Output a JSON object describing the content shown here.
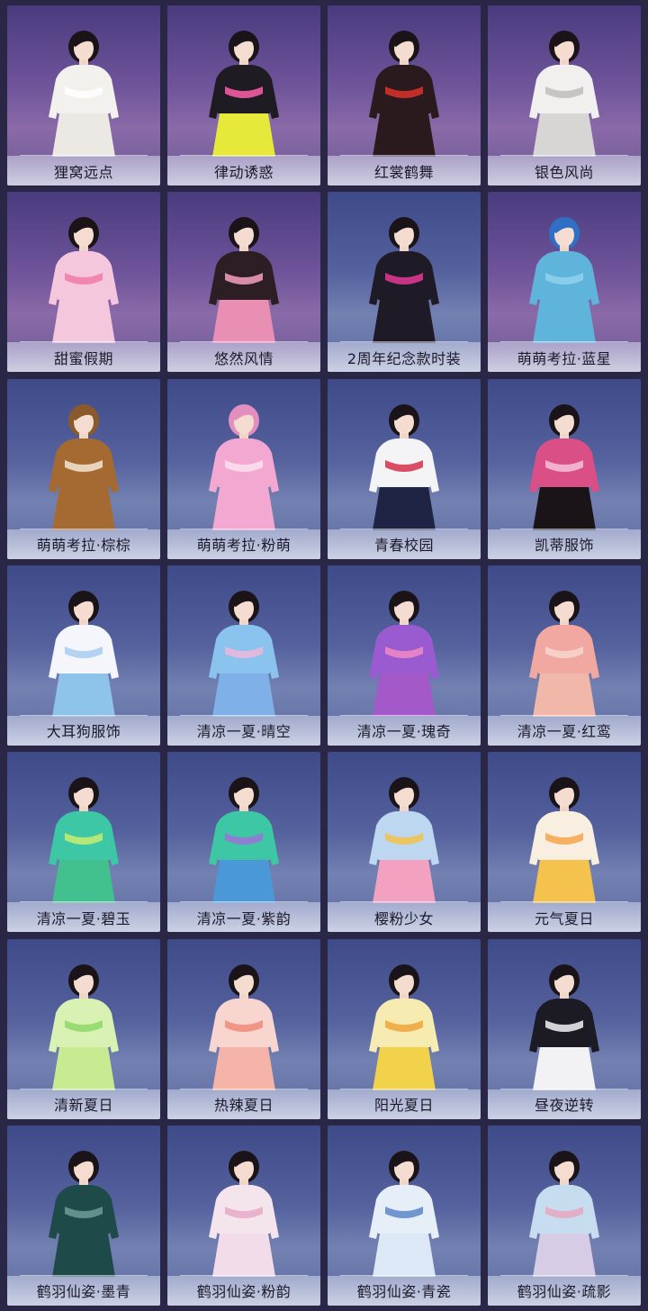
{
  "gallery": {
    "items": [
      {
        "label": "狸窝远点",
        "bg": "purple",
        "hair": "#1a1418",
        "top": "#f3f1ee",
        "bottom": "#ece8e4",
        "accent": "#ffffff"
      },
      {
        "label": "律动诱惑",
        "bg": "purple",
        "hair": "#1a1418",
        "top": "#1f1b22",
        "bottom": "#e6e83a",
        "accent": "#ff5fa8"
      },
      {
        "label": "红裳鹤舞",
        "bg": "purple",
        "hair": "#1a1418",
        "top": "#2a1a1e",
        "bottom": "#2a1a1e",
        "accent": "#d9322b"
      },
      {
        "label": "银色风尚",
        "bg": "purple",
        "hair": "#1a1418",
        "top": "#f2f0ee",
        "bottom": "#d8d6d4",
        "accent": "#bfbcb8"
      },
      {
        "label": "甜蜜假期",
        "bg": "purple",
        "hair": "#1a1418",
        "top": "#f5c7dc",
        "bottom": "#f5c7dc",
        "accent": "#f07aa9"
      },
      {
        "label": "悠然风情",
        "bg": "purple",
        "hair": "#1a1418",
        "top": "#2c1e24",
        "bottom": "#e98fb4",
        "accent": "#f6a0c2"
      },
      {
        "label": "2周年纪念款时装",
        "bg": "blue",
        "hair": "#1a1418",
        "top": "#1e1a26",
        "bottom": "#1e1a26",
        "accent": "#e53a94"
      },
      {
        "label": "萌萌考拉·蓝星",
        "bg": "purple",
        "hair": "#2f6fc6",
        "top": "#5fb4dc",
        "bottom": "#5fb4dc",
        "accent": "#8fd2ec"
      },
      {
        "label": "萌萌考拉·棕棕",
        "bg": "blue",
        "hair": "#8a5a2c",
        "top": "#a56a32",
        "bottom": "#a56a32",
        "accent": "#f3e6d4"
      },
      {
        "label": "萌萌考拉·粉萌",
        "bg": "blue",
        "hair": "#e28fc0",
        "top": "#f3a8d2",
        "bottom": "#f3a8d2",
        "accent": "#fbe0ee"
      },
      {
        "label": "青春校园",
        "bg": "blue",
        "hair": "#1a1418",
        "top": "#f4f4f6",
        "bottom": "#1f2444",
        "accent": "#d3304a"
      },
      {
        "label": "凯蒂服饰",
        "bg": "blue",
        "hair": "#1a1418",
        "top": "#d94f86",
        "bottom": "#1a1418",
        "accent": "#f5c2d8"
      },
      {
        "label": "大耳狗服饰",
        "bg": "blue",
        "hair": "#1a1418",
        "top": "#f4f6fb",
        "bottom": "#8fc4ea",
        "accent": "#a8cdf0"
      },
      {
        "label": "清凉一夏·晴空",
        "bg": "blue",
        "hair": "#1a1418",
        "top": "#8bc3ef",
        "bottom": "#7fb1e8",
        "accent": "#f0b7d8"
      },
      {
        "label": "清凉一夏·瑰奇",
        "bg": "blue",
        "hair": "#1a1418",
        "top": "#9a5ad0",
        "bottom": "#a35ac8",
        "accent": "#f08ac4"
      },
      {
        "label": "清凉一夏·红鸾",
        "bg": "blue",
        "hair": "#1a1418",
        "top": "#f1a8a0",
        "bottom": "#f1b8aa",
        "accent": "#f7d6cd"
      },
      {
        "label": "清凉一夏·碧玉",
        "bg": "blue",
        "hair": "#1a1418",
        "top": "#3ec7a4",
        "bottom": "#42c08e",
        "accent": "#c9ec72"
      },
      {
        "label": "清凉一夏·紫韵",
        "bg": "blue",
        "hair": "#1a1418",
        "top": "#3ec7a4",
        "bottom": "#4a98d8",
        "accent": "#9c72d8"
      },
      {
        "label": "樱粉少女",
        "bg": "blue",
        "hair": "#1a1418",
        "top": "#bcd7ef",
        "bottom": "#f2a2c0",
        "accent": "#f4c24a"
      },
      {
        "label": "元气夏日",
        "bg": "blue",
        "hair": "#1a1418",
        "top": "#f8efe0",
        "bottom": "#f5c24e",
        "accent": "#f5a54a"
      },
      {
        "label": "清新夏日",
        "bg": "blue",
        "hair": "#1a1418",
        "top": "#d9f1b2",
        "bottom": "#c8eb92",
        "accent": "#8ed868"
      },
      {
        "label": "热辣夏日",
        "bg": "blue",
        "hair": "#1a1418",
        "top": "#f8d6cf",
        "bottom": "#f6b4a8",
        "accent": "#f08a7a"
      },
      {
        "label": "阳光夏日",
        "bg": "blue",
        "hair": "#1a1418",
        "top": "#f6ecb2",
        "bottom": "#f2d24a",
        "accent": "#f0a53a"
      },
      {
        "label": "昼夜逆转",
        "bg": "blue",
        "hair": "#1a1418",
        "top": "#1c1a22",
        "bottom": "#f2f2f4",
        "accent": "#f2f2f4"
      },
      {
        "label": "鹤羽仙姿·墨青",
        "bg": "blue",
        "hair": "#1a1418",
        "top": "#1f4a4a",
        "bottom": "#1f4a4a",
        "accent": "#6e9e96"
      },
      {
        "label": "鹤羽仙姿·粉韵",
        "bg": "blue",
        "hair": "#1a1418",
        "top": "#f4e4ec",
        "bottom": "#f2dcea",
        "accent": "#e6a9c8"
      },
      {
        "label": "鹤羽仙姿·青瓷",
        "bg": "blue",
        "hair": "#1a1418",
        "top": "#e6eef8",
        "bottom": "#dde8f6",
        "accent": "#5a86c8"
      },
      {
        "label": "鹤羽仙姿·疏影",
        "bg": "blue",
        "hair": "#1a1418",
        "top": "#c6dcef",
        "bottom": "#d6cce6",
        "accent": "#e8a6bf"
      }
    ]
  },
  "colors": {
    "page_background": "#2a2645",
    "label_text": "#1c1a2a"
  }
}
